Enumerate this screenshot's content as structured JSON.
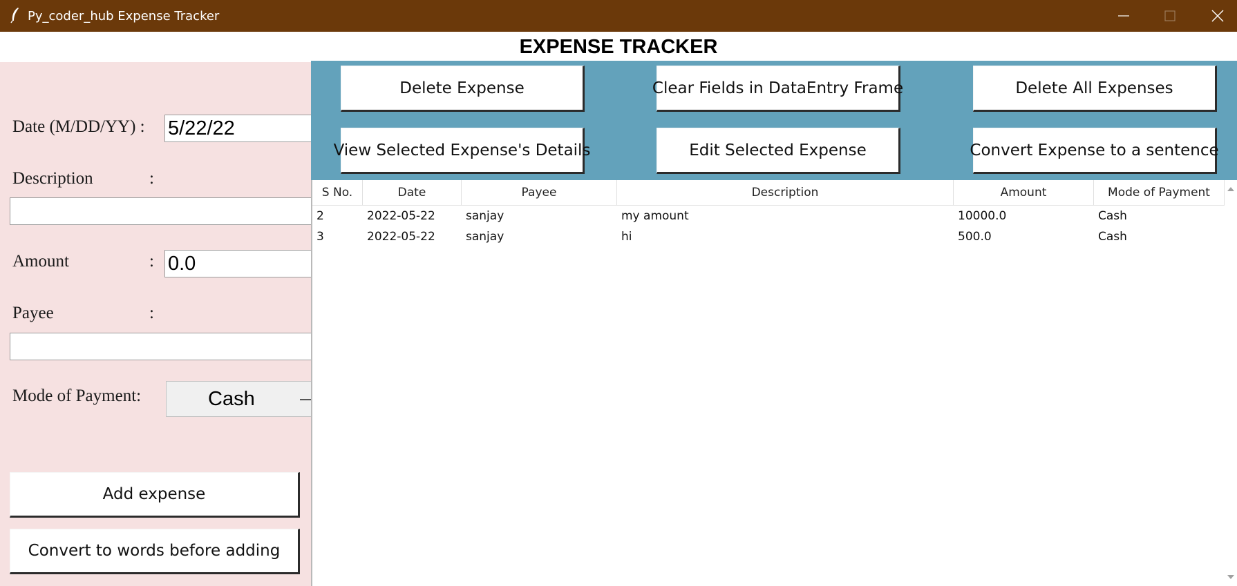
{
  "window": {
    "title": "Py_coder_hub Expense Tracker",
    "app_icon": "feather-icon",
    "controls": [
      "minimize-icon",
      "maximize-icon",
      "close-icon"
    ]
  },
  "header": {
    "title": "EXPENSE TRACKER"
  },
  "colors": {
    "titlebar": "#6b390a",
    "left_panel": "#f6e1e1",
    "button_area": "#63a2bb"
  },
  "form": {
    "date_label": "Date (M/DD/YY) :",
    "date_value": "5/22/22",
    "description_label": "Description",
    "description_colon": ":",
    "description_value": "",
    "amount_label": "Amount",
    "amount_colon": ":",
    "amount_value": "0.0",
    "payee_label": "Payee",
    "payee_colon": ":",
    "payee_value": "",
    "mode_label": "Mode of Payment:",
    "mode_value": "Cash",
    "add_button": "Add expense",
    "convert_button": "Convert to words before adding"
  },
  "actions": {
    "delete_expense": "Delete Expense",
    "clear_fields": "Clear Fields in DataEntry Frame",
    "delete_all": "Delete All Expenses",
    "view_details": "View Selected Expense's Details",
    "edit_expense": "Edit Selected Expense",
    "convert_sentence": "Convert Expense to a sentence"
  },
  "table": {
    "columns": [
      "S No.",
      "Date",
      "Payee",
      "Description",
      "Amount",
      "Mode of Payment"
    ],
    "rows": [
      [
        "2",
        "2022-05-22",
        "sanjay",
        "my amount",
        "10000.0",
        "Cash"
      ],
      [
        "3",
        "2022-05-22",
        "sanjay",
        "hi",
        "500.0",
        "Cash"
      ]
    ]
  }
}
